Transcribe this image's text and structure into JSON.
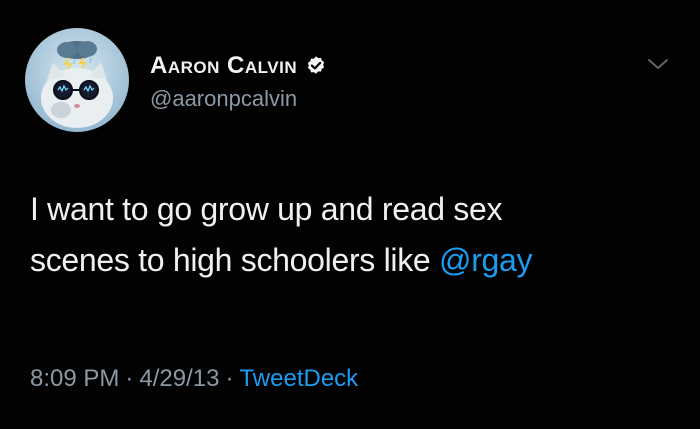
{
  "user": {
    "display_name": "Aaron Calvin",
    "handle": "@aaronpcalvin",
    "verified": true
  },
  "tweet": {
    "text_line1": "I want to go grow up and read sex",
    "text_line2_prefix": "scenes to high schoolers like ",
    "mention": "@rgay"
  },
  "meta": {
    "time": "8:09 PM",
    "separator": "·",
    "date": "4/29/13",
    "source": "TweetDeck"
  },
  "icons": {
    "avatar": "cat-with-glasses-and-storm-cloud-avatar",
    "verified": "verified-badge-icon",
    "more": "chevron-down-icon"
  },
  "colors": {
    "background": "#000000",
    "link": "#1d9bf0",
    "secondary_text": "#8b98a5",
    "primary_text": "#f0f0f0"
  }
}
